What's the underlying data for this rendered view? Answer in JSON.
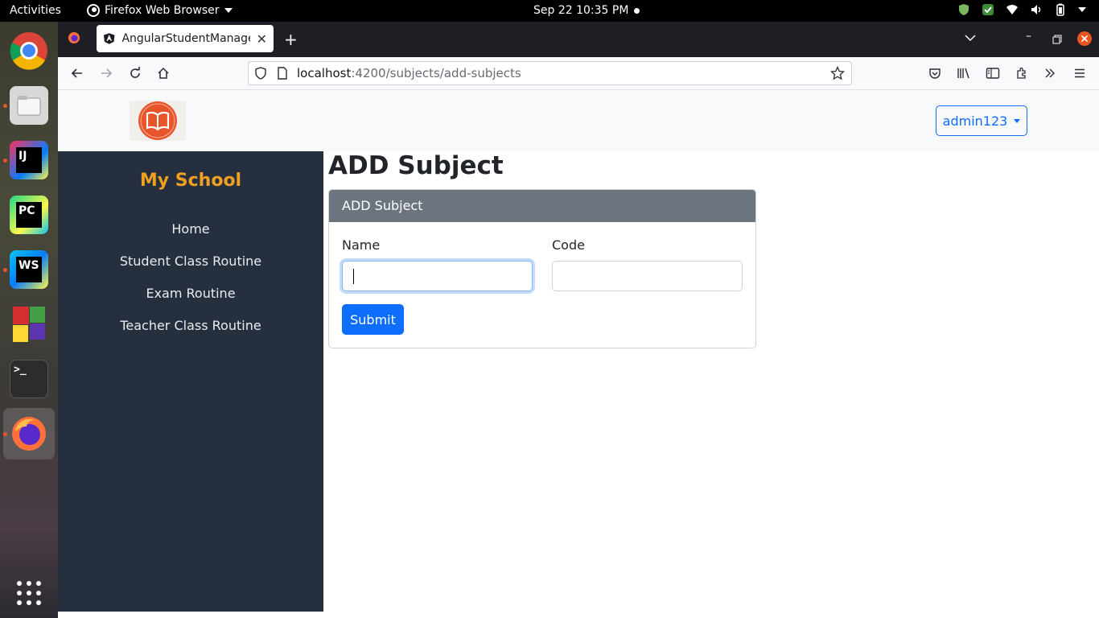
{
  "system_bar": {
    "activities": "Activities",
    "app_name": "Firefox Web Browser",
    "datetime": "Sep 22  10:35 PM"
  },
  "dock": {
    "items": [
      "chrome-icon",
      "files-icon",
      "intellij-icon",
      "pycharm-icon",
      "webstorm-icon",
      "app-grid-apps-icon",
      "terminal-icon",
      "firefox-icon",
      "show-apps-icon"
    ],
    "labels": {
      "intellij": "IJ",
      "pycharm": "PC",
      "webstorm": "WS",
      "terminal": ">_"
    }
  },
  "browser": {
    "tab_title": "AngularStudentManagement",
    "url_host": "localhost",
    "url_path": ":4200/subjects/add-subjects"
  },
  "header": {
    "user_menu_label": "admin123"
  },
  "sidebar": {
    "brand": "My School",
    "items": [
      {
        "label": "Home"
      },
      {
        "label": "Student Class Routine"
      },
      {
        "label": "Exam Routine"
      },
      {
        "label": "Teacher Class Routine"
      }
    ]
  },
  "main": {
    "title": "ADD Subject",
    "card_header": "ADD Subject",
    "form": {
      "name_label": "Name",
      "name_value": "",
      "code_label": "Code",
      "code_value": "",
      "submit_label": "Submit"
    }
  },
  "colors": {
    "brand_orange": "#f0a020",
    "sidebar_bg": "#262f3e",
    "primary": "#0d6efd",
    "card_header_bg": "#6c757d",
    "logo_orange": "#e8552a"
  }
}
